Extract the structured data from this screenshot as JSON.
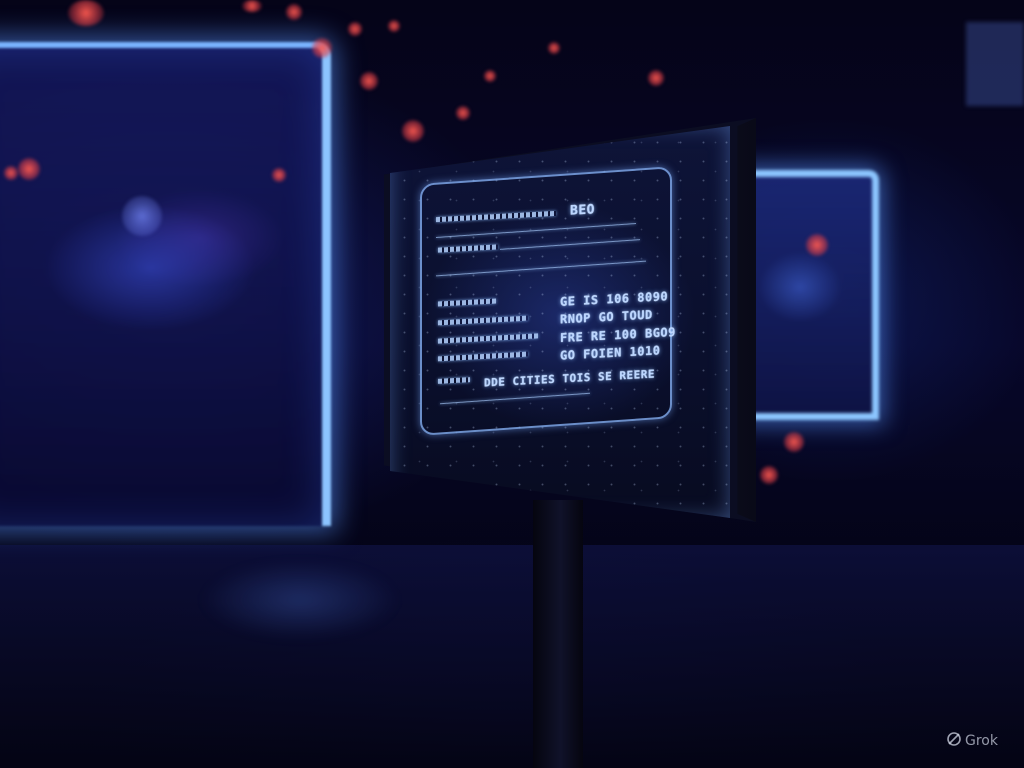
{
  "screen": {
    "header_code": "BEO",
    "rows": [
      {
        "value": "GE IS 106 8090"
      },
      {
        "value": "RNOP GO TOUD"
      },
      {
        "value": "FRE RE 100 BGO9"
      },
      {
        "value": "GO FOIEN 1010"
      }
    ],
    "footer_text": "DDE CITIES TOIS SE REERE"
  },
  "watermark": {
    "text": "Grok"
  },
  "colors": {
    "glow_blue": "#8cc4ff",
    "screen_text": "#bcd6ff",
    "bokeh_red": "#ff5a50",
    "background": "#04030f"
  }
}
